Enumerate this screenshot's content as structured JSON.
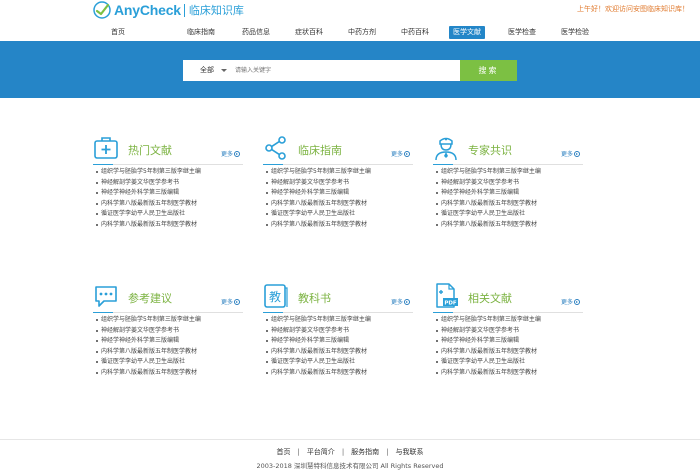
{
  "logo": {
    "brand": "AnyCheck",
    "subtitle": "临床知识库"
  },
  "greeting": "上午好！欢迎访问安图临床知识库！",
  "nav": [
    {
      "label": "首页"
    },
    {
      "label": "临床指南"
    },
    {
      "label": "药品信息"
    },
    {
      "label": "症状百科"
    },
    {
      "label": "中药方剂"
    },
    {
      "label": "中药百科"
    },
    {
      "label": "医学文献",
      "active": true
    },
    {
      "label": "医学检查"
    },
    {
      "label": "医学检验"
    }
  ],
  "search": {
    "scope": "全部",
    "placeholder": "请输入关键字",
    "button": "搜索"
  },
  "cards": [
    {
      "title": "热门文献",
      "icon": "medical-kit-icon",
      "more": "更多",
      "items": [
        "组织学与胚胎学5年制第三版李继主编",
        "神经解剖学姜文华医学参考书",
        "神经学神经外科学第三版编辑",
        "内科学第八版最新版五年制医学教材",
        "循证医学李幼平人民卫生出版社",
        "内科学第八版最新版五年制医学教材"
      ]
    },
    {
      "title": "临床指南",
      "icon": "share-icon",
      "more": "更多",
      "items": [
        "组织学与胚胎学5年制第三版李继主编",
        "神经解剖学姜文华医学参考书",
        "神经学神经外科学第三版编辑",
        "内科学第八版最新版五年制医学教材",
        "循证医学李幼平人民卫生出版社",
        "内科学第八版最新版五年制医学教材"
      ]
    },
    {
      "title": "专家共识",
      "icon": "doctor-icon",
      "more": "更多",
      "items": [
        "组织学与胚胎学5年制第三版李继主编",
        "神经解剖学姜文华医学参考书",
        "神经学神经外科学第三版编辑",
        "内科学第八版最新版五年制医学教材",
        "循证医学李幼平人民卫生出版社",
        "内科学第八版最新版五年制医学教材"
      ]
    },
    {
      "title": "参考建议",
      "icon": "chat-bubble-icon",
      "more": "更多",
      "items": [
        "组织学与胚胎学5年制第三版李继主编",
        "神经解剖学姜文华医学参考书",
        "神经学神经外科学第三版编辑",
        "内科学第八版最新版五年制医学教材",
        "循证医学李幼平人民卫生出版社",
        "内科学第八版最新版五年制医学教材"
      ]
    },
    {
      "title": "教科书",
      "icon": "textbook-icon",
      "more": "更多",
      "items": [
        "组织学与胚胎学5年制第三版李继主编",
        "神经解剖学姜文华医学参考书",
        "神经学神经外科学第三版编辑",
        "内科学第八版最新版五年制医学教材",
        "循证医学李幼平人民卫生出版社",
        "内科学第八版最新版五年制医学教材"
      ]
    },
    {
      "title": "相关文献",
      "icon": "pdf-icon",
      "more": "更多",
      "items": [
        "组织学与胚胎学5年制第三版李继主编",
        "神经解剖学姜文华医学参考书",
        "神经学神经外科学第三版编辑",
        "内科学第八版最新版五年制医学教材",
        "循证医学李幼平人民卫生出版社",
        "内科学第八版最新版五年制医学教材"
      ]
    }
  ],
  "icon_glyphs": {
    "textbook": "教",
    "pdf": "PDF"
  },
  "footer": {
    "links": [
      "首页",
      "平台简介",
      "服务指南",
      "与我联系"
    ],
    "copyright": "2003-2018 深圳慧特科信息技术有限公司 All Rights Reserved"
  },
  "colors": {
    "primary_blue": "#2585c7",
    "accent_green": "#7cc043",
    "title_green": "#7cb342",
    "greeting_orange": "#e07a2e"
  }
}
